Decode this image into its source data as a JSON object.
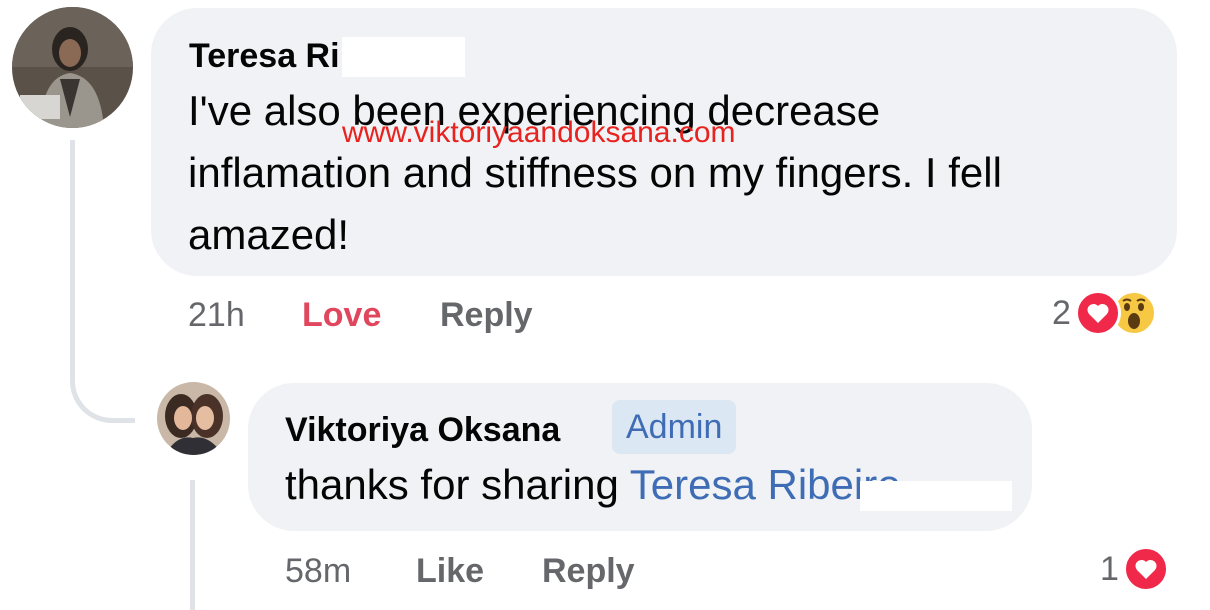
{
  "watermark": "www.viktoriyaandoksana.com",
  "comment": {
    "author": "Teresa Ri",
    "lines": [
      "I've also been experiencing decrease",
      "inflamation and stiffness on my fingers. I fell",
      "amazed!"
    ],
    "time": "21h",
    "love_label": "Love",
    "reply_label": "Reply",
    "reaction_count": "2",
    "reactions": [
      "love-icon",
      "wow-icon"
    ]
  },
  "reply": {
    "author": "Viktoriya Oksana",
    "badge": "Admin",
    "text_prefix": "thanks for sharing ",
    "mention": "Teresa Ribeiro",
    "time": "58m",
    "like_label": "Like",
    "reply_label": "Reply",
    "reaction_count": "1",
    "reactions": [
      "love-icon"
    ]
  },
  "colors": {
    "bubble_bg": "#f0f2f5",
    "love_red": "#e0475e",
    "link_blue": "#3f6db5",
    "meta_gray": "#65676b",
    "watermark_red": "#e8221e"
  }
}
